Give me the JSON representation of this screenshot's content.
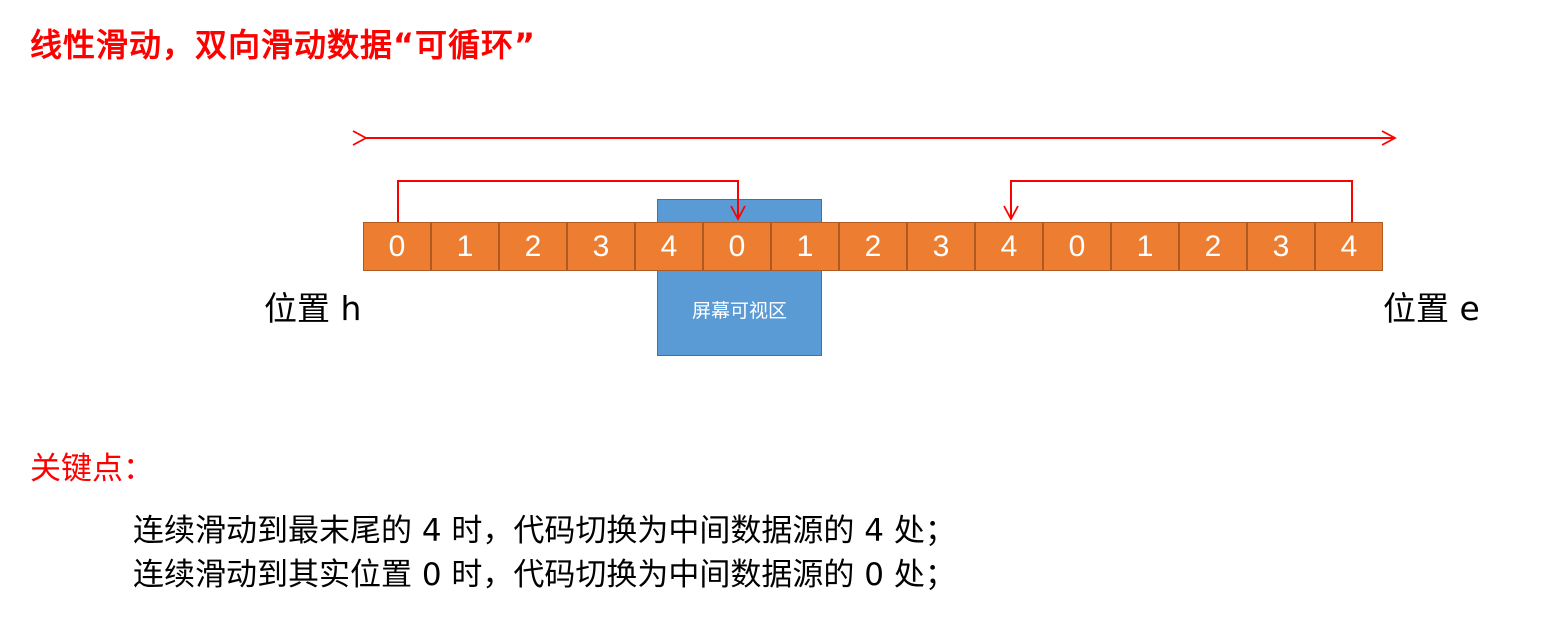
{
  "title": "线性滑动，双向滑动数据“可循环”",
  "viewport_label": "屏幕可视区",
  "cells": [
    "0",
    "1",
    "2",
    "3",
    "4",
    "0",
    "1",
    "2",
    "3",
    "4",
    "0",
    "1",
    "2",
    "3",
    "4"
  ],
  "position_start": "位置 h",
  "position_end": "位置 e",
  "key_points": {
    "heading": "关键点：",
    "lines": [
      "连续滑动到最末尾的 4  时，代码切换为中间数据源的 4 处；",
      "连续滑动到其实位置 0 时，代码切换为中间数据源的 0 处；"
    ]
  },
  "colors": {
    "cell_fill": "#ed7d31",
    "viewport_fill": "#5b9bd5",
    "arrow": "#ff0000",
    "title": "#ff0000"
  }
}
